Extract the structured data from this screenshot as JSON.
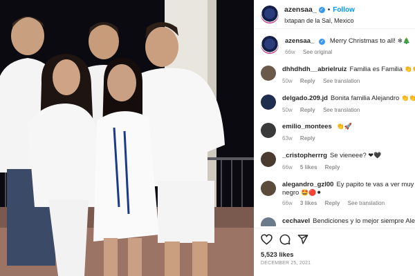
{
  "post": {
    "username": "azensaa_",
    "follow_label": "Follow",
    "location": "Ixtapan de la Sal, Mexico",
    "separator": "•"
  },
  "caption": {
    "username": "azensaa_",
    "text": "Merry Christmas to all!",
    "emoji": "❄🎄",
    "time": "66w",
    "see_original": "See original"
  },
  "comments": [
    {
      "username": "dhhdhdh__abrielruiz",
      "text": "Familia es Familia",
      "emoji": "👏👏👏",
      "time": "50w",
      "reply": "Reply",
      "likes": "",
      "translation": "See translation",
      "avatar_color": "#6b5a4a"
    },
    {
      "username": "delgado.209.jd",
      "text": "Bonita familia Alejandro",
      "emoji": "👏👏👏",
      "time": "50w",
      "reply": "Reply",
      "likes": "",
      "translation": "See translation",
      "avatar_color": "#1f2d4f"
    },
    {
      "username": "emilio_montees",
      "text": "",
      "emoji": "👏🚀",
      "time": "63w",
      "reply": "Reply",
      "likes": "",
      "translation": "",
      "avatar_color": "#3a3a3a"
    },
    {
      "username": "_cristopherrrg",
      "text": "Se vieneee?",
      "emoji": "❤🖤",
      "time": "66w",
      "reply": "Reply",
      "likes": "5 likes",
      "translation": "",
      "avatar_color": "#4a3b30"
    },
    {
      "username": "alegandro_gzl00",
      "text": "Ey papito te vas a ver muy bien",
      "text2": "negro",
      "emoji": "🤩🔴⚫",
      "time": "66w",
      "reply": "Reply",
      "likes": "3 likes",
      "translation": "See translation",
      "avatar_color": "#5a4b3a"
    },
    {
      "username": "cechavel",
      "text": "Bendiciones y lo mejor siempre Alex!",
      "emoji": "🙏",
      "time": "",
      "reply": "",
      "likes": "",
      "translation": "",
      "avatar_color": "#6a7a8a"
    }
  ],
  "actions": {
    "likes": "5,523 likes",
    "date": "DECEMBER 25, 2021",
    "icons": [
      "heart-icon",
      "comment-icon",
      "share-icon"
    ]
  },
  "colors": {
    "accent": "#0095f6",
    "verified": "#3897f0",
    "muted": "#8e8e8e"
  }
}
